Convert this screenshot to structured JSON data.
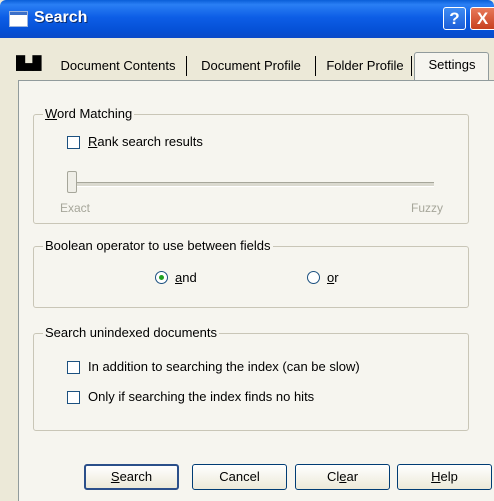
{
  "window": {
    "title": "Search",
    "help_label": "?",
    "close_label": "X"
  },
  "tabs": [
    {
      "label": "Document Contents"
    },
    {
      "label": "Document Profile"
    },
    {
      "label": "Folder Profile"
    },
    {
      "label": "Settings",
      "active": true
    }
  ],
  "word_matching": {
    "legend_pre": "",
    "legend_mnemonic": "W",
    "legend_post": "ord Matching",
    "rank_pre": "",
    "rank_mnemonic": "R",
    "rank_post": "ank search results",
    "rank_checked": false,
    "slider_value": 0,
    "slider_min_label": "Exact",
    "slider_max_label": "Fuzzy"
  },
  "boolean": {
    "legend": "Boolean operator to use between fields",
    "and_mnemonic": "a",
    "and_post": "nd",
    "or_mnemonic": "o",
    "or_post": "r",
    "selected": "and"
  },
  "unindexed": {
    "legend": "Search unindexed documents",
    "option1": "In addition to searching the index (can be slow)",
    "option2": "Only if searching the index finds no hits",
    "option1_checked": false,
    "option2_checked": false
  },
  "buttons": {
    "search_mnemonic": "S",
    "search_post": "earch",
    "cancel": "Cancel",
    "clear_pre": "Cl",
    "clear_mnemonic": "e",
    "clear_post": "ar",
    "help_mnemonic": "H",
    "help_post": "elp"
  },
  "colors": {
    "titlebar": "#0550d6",
    "dialog_bg": "#ece9d8",
    "panel_bg": "#f6f5ef"
  }
}
